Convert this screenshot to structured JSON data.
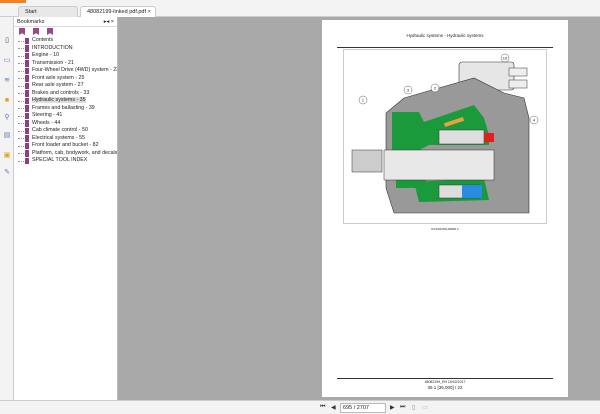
{
  "tabs": [
    {
      "label": "Start"
    },
    {
      "label": "48082199-linked pdf.pdf",
      "close": "×"
    }
  ],
  "bookmarks": {
    "title": "Bookmarks",
    "controls": "▸◂ ×",
    "items": [
      "Contents",
      "INTRODUCTION",
      "Engine - 10",
      "Transmission - 21",
      "Four-Wheel Drive (4WD) system - 23",
      "Front axle system - 25",
      "Rear axle system - 27",
      "Brakes and controls - 33",
      "Hydraulic systems - 35",
      "Frames and ballasting - 39",
      "Steering - 41",
      "Wheels - 44",
      "Cab climate control - 50",
      "Electrical systems - 55",
      "Front loader and bucket - 82",
      "Platform, cab, bodywork, and decals - 90",
      "SPECIAL TOOL INDEX"
    ],
    "selected_index": 8
  },
  "document": {
    "header": "Hydraulic systems - Hydraulic systems",
    "figure_caption": "RCPH10WL00800   2",
    "callouts": [
      "1",
      "3",
      "2",
      "10",
      "4"
    ],
    "footer_doc": "48082199_EN 19/02/2017",
    "footer_page": "35.1 [35.000] / 22"
  },
  "navigation": {
    "page_value": "695 / 2707",
    "first": "⏮",
    "prev": "◀",
    "next": "▶",
    "last": "⏭"
  },
  "colors": {
    "accent": "#f08020",
    "bookmark": "#8c3f86",
    "green": "#1a9a3a",
    "red": "#e02020",
    "blue": "#2a8ce0"
  }
}
